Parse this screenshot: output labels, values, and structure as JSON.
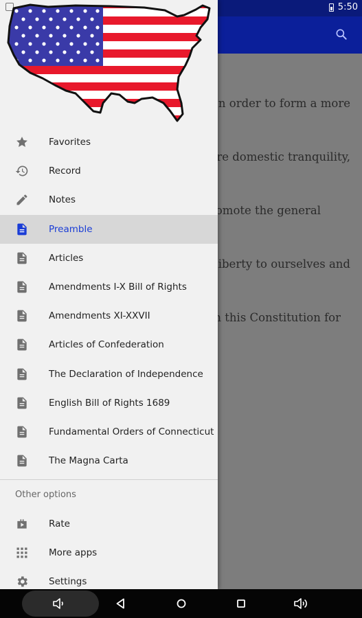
{
  "status": {
    "time": "5:50"
  },
  "main": {
    "content_lines": [
      "n order to form a more",
      "re domestic tranquility,",
      "omote the general",
      "liberty to ourselves and",
      "h this Constitution for"
    ]
  },
  "drawer": {
    "items": [
      {
        "label": "Favorites",
        "icon": "star-icon"
      },
      {
        "label": "Record",
        "icon": "history-icon"
      },
      {
        "label": "Notes",
        "icon": "pencil-icon"
      },
      {
        "label": "Preamble",
        "icon": "document-icon",
        "selected": true
      },
      {
        "label": "Articles",
        "icon": "document-icon"
      },
      {
        "label": "Amendments I-X Bill of Rights",
        "icon": "document-icon"
      },
      {
        "label": "Amendments XI-XXVII",
        "icon": "document-icon"
      },
      {
        "label": "Articles of Confederation",
        "icon": "document-icon"
      },
      {
        "label": "The Declaration of Independence",
        "icon": "document-icon"
      },
      {
        "label": "English Bill of Rights 1689",
        "icon": "document-icon"
      },
      {
        "label": "Fundamental Orders of Connecticut",
        "icon": "document-icon"
      },
      {
        "label": "The Magna Carta",
        "icon": "document-icon"
      }
    ],
    "other_title": "Other options",
    "other_items": [
      {
        "label": "Rate",
        "icon": "shop-icon"
      },
      {
        "label": "More apps",
        "icon": "grid-icon"
      },
      {
        "label": "Settings",
        "icon": "gear-icon"
      }
    ]
  },
  "colors": {
    "app_bar": "#0b1f9a",
    "selected_text": "#1a3dd6",
    "selected_bg": "#d7d7d7",
    "drawer_bg": "#f1f1f1"
  }
}
